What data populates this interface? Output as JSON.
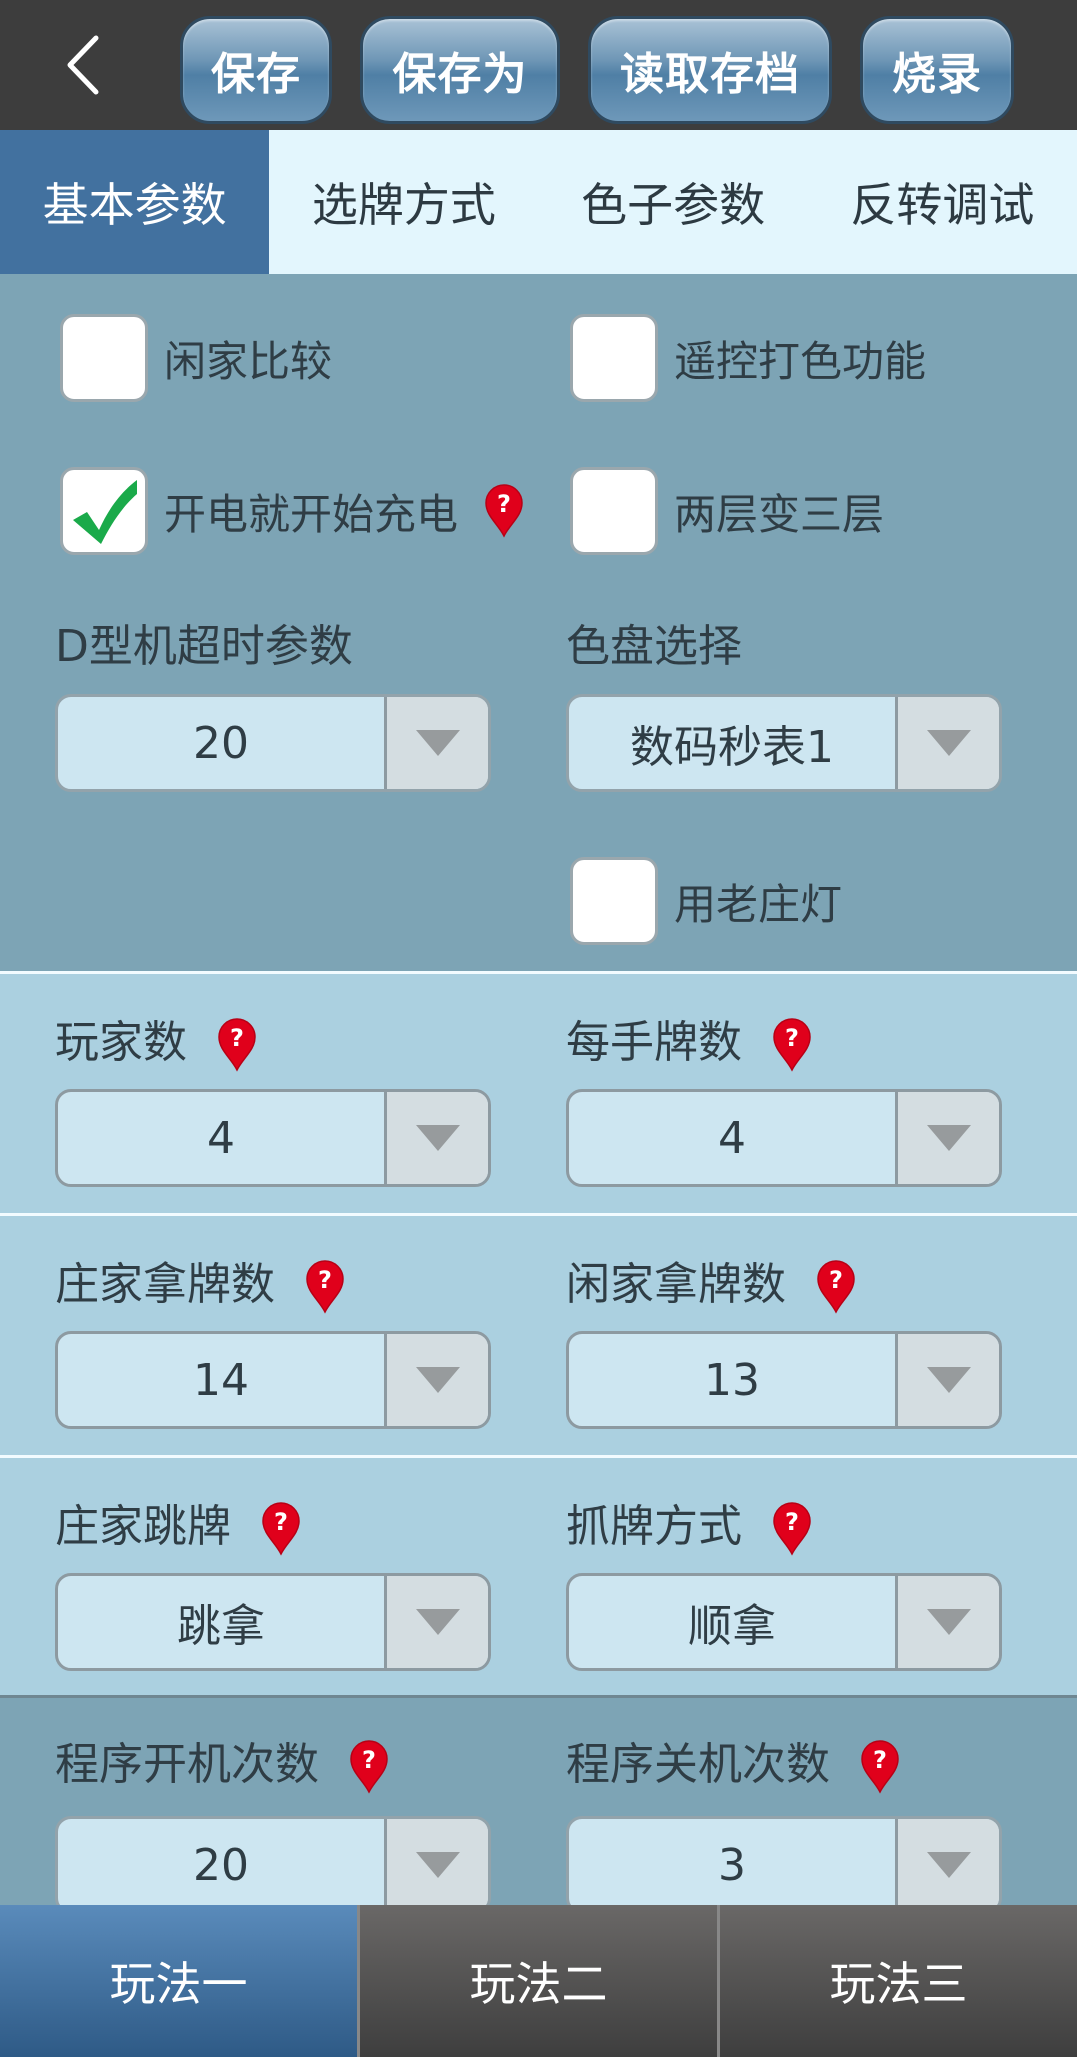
{
  "toolbar": {
    "back_icon": "chevron-left-icon",
    "buttons": [
      "保存",
      "保存为",
      "读取存档",
      "烧录"
    ]
  },
  "tabs": [
    {
      "label": "基本参数",
      "active": true
    },
    {
      "label": "选牌方式",
      "active": false
    },
    {
      "label": "色子参数",
      "active": false
    },
    {
      "label": "反转调试",
      "active": false
    }
  ],
  "section1": {
    "checkboxes": [
      {
        "label": "闲家比较",
        "checked": false,
        "help": false
      },
      {
        "label": "遥控打色功能",
        "checked": false,
        "help": false
      },
      {
        "label": "开电就开始充电",
        "checked": true,
        "help": true
      },
      {
        "label": "两层变三层",
        "checked": false,
        "help": false
      },
      {
        "label": "用老庄灯",
        "checked": false,
        "help": false
      }
    ],
    "fields": [
      {
        "label": "D型机超时参数",
        "value": "20"
      },
      {
        "label": "色盘选择",
        "value": "数码秒表1"
      }
    ]
  },
  "section2": {
    "fields": [
      {
        "label": "玩家数",
        "value": "4"
      },
      {
        "label": "每手牌数",
        "value": "4"
      }
    ]
  },
  "section3": {
    "fields": [
      {
        "label": "庄家拿牌数",
        "value": "14"
      },
      {
        "label": "闲家拿牌数",
        "value": "13"
      }
    ]
  },
  "section4": {
    "fields": [
      {
        "label": "庄家跳牌",
        "value": "跳拿"
      },
      {
        "label": "抓牌方式",
        "value": "顺拿"
      }
    ]
  },
  "section5": {
    "fields": [
      {
        "label": "程序开机次数",
        "value": "20"
      },
      {
        "label": "程序关机次数",
        "value": "3"
      }
    ]
  },
  "bottom_nav": [
    {
      "label": "玩法一",
      "active": true
    },
    {
      "label": "玩法二",
      "active": false
    },
    {
      "label": "玩法三",
      "active": false
    }
  ],
  "colors": {
    "accent": "#42719f",
    "help_icon": "#e0001b",
    "check": "#1aaa4a"
  }
}
